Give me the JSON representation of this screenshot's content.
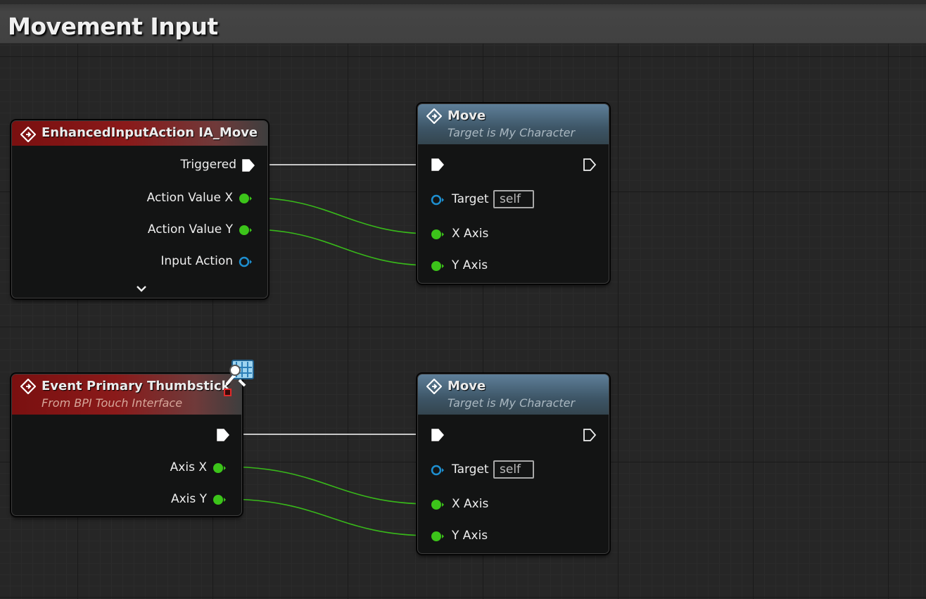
{
  "comment": {
    "title": "Movement Input"
  },
  "nodes": {
    "enhanced_input": {
      "title": "EnhancedInputAction IA_Move",
      "pins": {
        "triggered": "Triggered",
        "action_value_x": "Action Value X",
        "action_value_y": "Action Value Y",
        "input_action": "Input Action"
      }
    },
    "move_1": {
      "title": "Move",
      "subtitle": "Target is My Character",
      "pins": {
        "target": "Target",
        "target_value": "self",
        "x_axis": "X Axis",
        "y_axis": "Y Axis"
      }
    },
    "thumbstick": {
      "title": "Event Primary Thumbstick",
      "subtitle": "From BPI Touch Interface",
      "pins": {
        "axis_x": "Axis X",
        "axis_y": "Axis Y"
      }
    },
    "move_2": {
      "title": "Move",
      "subtitle": "Target is My Character",
      "pins": {
        "target": "Target",
        "target_value": "self",
        "x_axis": "X Axis",
        "y_axis": "Y Axis"
      }
    }
  },
  "colors": {
    "exec_wire": "#d8d8d8",
    "float_wire": "#3cc41a",
    "object_pin": "#1e8fd0",
    "event_header": "#8a1a1a",
    "function_header": "#4f6b80"
  },
  "icons": [
    "event-diamond-icon",
    "function-diamond-icon",
    "exec-pin-icon",
    "float-pin-icon",
    "object-pin-icon",
    "expand-chevron-icon",
    "interface-badge-icon"
  ]
}
